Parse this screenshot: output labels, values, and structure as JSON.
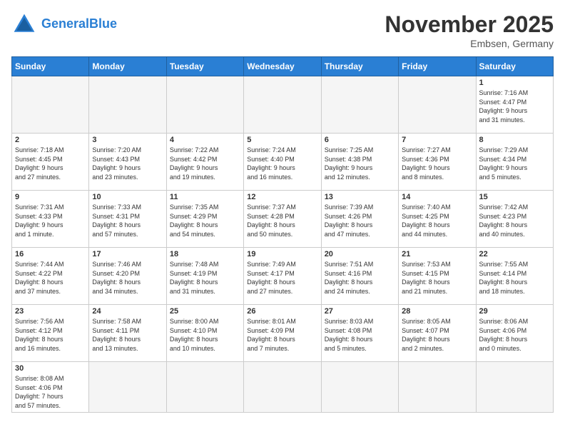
{
  "header": {
    "logo_general": "General",
    "logo_blue": "Blue",
    "month": "November 2025",
    "location": "Embsen, Germany"
  },
  "days_of_week": [
    "Sunday",
    "Monday",
    "Tuesday",
    "Wednesday",
    "Thursday",
    "Friday",
    "Saturday"
  ],
  "weeks": [
    [
      {
        "day": "",
        "info": ""
      },
      {
        "day": "",
        "info": ""
      },
      {
        "day": "",
        "info": ""
      },
      {
        "day": "",
        "info": ""
      },
      {
        "day": "",
        "info": ""
      },
      {
        "day": "",
        "info": ""
      },
      {
        "day": "1",
        "info": "Sunrise: 7:16 AM\nSunset: 4:47 PM\nDaylight: 9 hours\nand 31 minutes."
      }
    ],
    [
      {
        "day": "2",
        "info": "Sunrise: 7:18 AM\nSunset: 4:45 PM\nDaylight: 9 hours\nand 27 minutes."
      },
      {
        "day": "3",
        "info": "Sunrise: 7:20 AM\nSunset: 4:43 PM\nDaylight: 9 hours\nand 23 minutes."
      },
      {
        "day": "4",
        "info": "Sunrise: 7:22 AM\nSunset: 4:42 PM\nDaylight: 9 hours\nand 19 minutes."
      },
      {
        "day": "5",
        "info": "Sunrise: 7:24 AM\nSunset: 4:40 PM\nDaylight: 9 hours\nand 16 minutes."
      },
      {
        "day": "6",
        "info": "Sunrise: 7:25 AM\nSunset: 4:38 PM\nDaylight: 9 hours\nand 12 minutes."
      },
      {
        "day": "7",
        "info": "Sunrise: 7:27 AM\nSunset: 4:36 PM\nDaylight: 9 hours\nand 8 minutes."
      },
      {
        "day": "8",
        "info": "Sunrise: 7:29 AM\nSunset: 4:34 PM\nDaylight: 9 hours\nand 5 minutes."
      }
    ],
    [
      {
        "day": "9",
        "info": "Sunrise: 7:31 AM\nSunset: 4:33 PM\nDaylight: 9 hours\nand 1 minute."
      },
      {
        "day": "10",
        "info": "Sunrise: 7:33 AM\nSunset: 4:31 PM\nDaylight: 8 hours\nand 57 minutes."
      },
      {
        "day": "11",
        "info": "Sunrise: 7:35 AM\nSunset: 4:29 PM\nDaylight: 8 hours\nand 54 minutes."
      },
      {
        "day": "12",
        "info": "Sunrise: 7:37 AM\nSunset: 4:28 PM\nDaylight: 8 hours\nand 50 minutes."
      },
      {
        "day": "13",
        "info": "Sunrise: 7:39 AM\nSunset: 4:26 PM\nDaylight: 8 hours\nand 47 minutes."
      },
      {
        "day": "14",
        "info": "Sunrise: 7:40 AM\nSunset: 4:25 PM\nDaylight: 8 hours\nand 44 minutes."
      },
      {
        "day": "15",
        "info": "Sunrise: 7:42 AM\nSunset: 4:23 PM\nDaylight: 8 hours\nand 40 minutes."
      }
    ],
    [
      {
        "day": "16",
        "info": "Sunrise: 7:44 AM\nSunset: 4:22 PM\nDaylight: 8 hours\nand 37 minutes."
      },
      {
        "day": "17",
        "info": "Sunrise: 7:46 AM\nSunset: 4:20 PM\nDaylight: 8 hours\nand 34 minutes."
      },
      {
        "day": "18",
        "info": "Sunrise: 7:48 AM\nSunset: 4:19 PM\nDaylight: 8 hours\nand 31 minutes."
      },
      {
        "day": "19",
        "info": "Sunrise: 7:49 AM\nSunset: 4:17 PM\nDaylight: 8 hours\nand 27 minutes."
      },
      {
        "day": "20",
        "info": "Sunrise: 7:51 AM\nSunset: 4:16 PM\nDaylight: 8 hours\nand 24 minutes."
      },
      {
        "day": "21",
        "info": "Sunrise: 7:53 AM\nSunset: 4:15 PM\nDaylight: 8 hours\nand 21 minutes."
      },
      {
        "day": "22",
        "info": "Sunrise: 7:55 AM\nSunset: 4:14 PM\nDaylight: 8 hours\nand 18 minutes."
      }
    ],
    [
      {
        "day": "23",
        "info": "Sunrise: 7:56 AM\nSunset: 4:12 PM\nDaylight: 8 hours\nand 16 minutes."
      },
      {
        "day": "24",
        "info": "Sunrise: 7:58 AM\nSunset: 4:11 PM\nDaylight: 8 hours\nand 13 minutes."
      },
      {
        "day": "25",
        "info": "Sunrise: 8:00 AM\nSunset: 4:10 PM\nDaylight: 8 hours\nand 10 minutes."
      },
      {
        "day": "26",
        "info": "Sunrise: 8:01 AM\nSunset: 4:09 PM\nDaylight: 8 hours\nand 7 minutes."
      },
      {
        "day": "27",
        "info": "Sunrise: 8:03 AM\nSunset: 4:08 PM\nDaylight: 8 hours\nand 5 minutes."
      },
      {
        "day": "28",
        "info": "Sunrise: 8:05 AM\nSunset: 4:07 PM\nDaylight: 8 hours\nand 2 minutes."
      },
      {
        "day": "29",
        "info": "Sunrise: 8:06 AM\nSunset: 4:06 PM\nDaylight: 8 hours\nand 0 minutes."
      }
    ],
    [
      {
        "day": "30",
        "info": "Sunrise: 8:08 AM\nSunset: 4:06 PM\nDaylight: 7 hours\nand 57 minutes."
      },
      {
        "day": "",
        "info": ""
      },
      {
        "day": "",
        "info": ""
      },
      {
        "day": "",
        "info": ""
      },
      {
        "day": "",
        "info": ""
      },
      {
        "day": "",
        "info": ""
      },
      {
        "day": "",
        "info": ""
      }
    ]
  ]
}
